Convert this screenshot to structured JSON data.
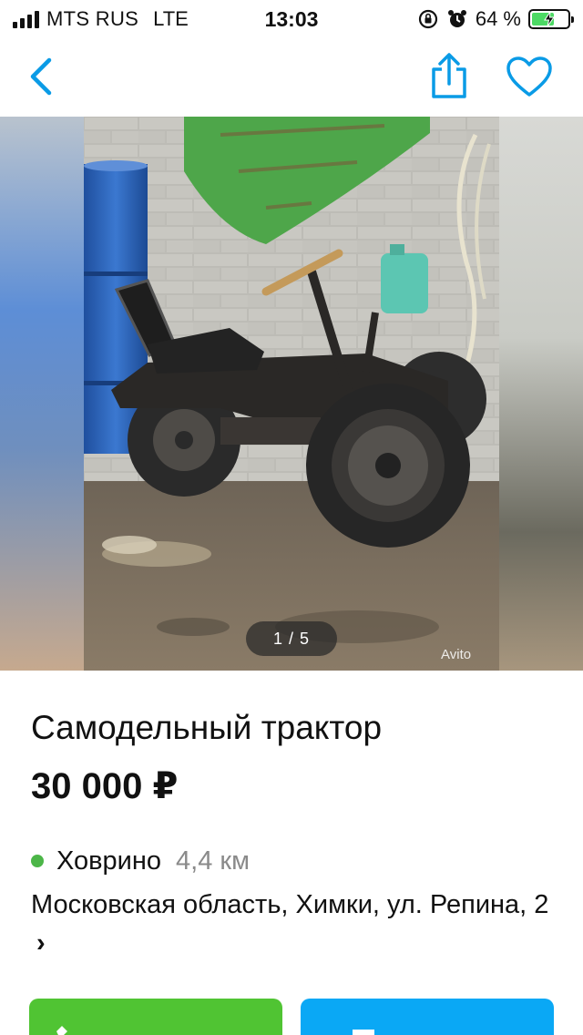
{
  "status_bar": {
    "carrier": "MTS RUS",
    "network": "LTE",
    "time": "13:03",
    "battery_percent": "64 %",
    "battery_level": 0.64,
    "battery_color": "#4cd964",
    "icons": [
      "signal-icon",
      "orientation-lock-icon",
      "alarm-icon",
      "battery-icon"
    ]
  },
  "nav": {
    "back_icon": "chevron-left-icon",
    "share_icon": "share-icon",
    "favorite_icon": "heart-icon",
    "accent_color": "#0a9be6"
  },
  "gallery": {
    "counter": "1 / 5",
    "watermark": "Avito"
  },
  "listing": {
    "title": "Самодельный трактор",
    "price": "30 000 ₽",
    "metro": {
      "name": "Ховрино",
      "distance": "4,4 км",
      "dot_color": "#4cb648"
    },
    "address": "Московская область, Химки, ул. Репина, 2",
    "address_chevron": "›"
  },
  "actions": {
    "call_color": "#50c433",
    "write_color": "#0aa8f5"
  }
}
